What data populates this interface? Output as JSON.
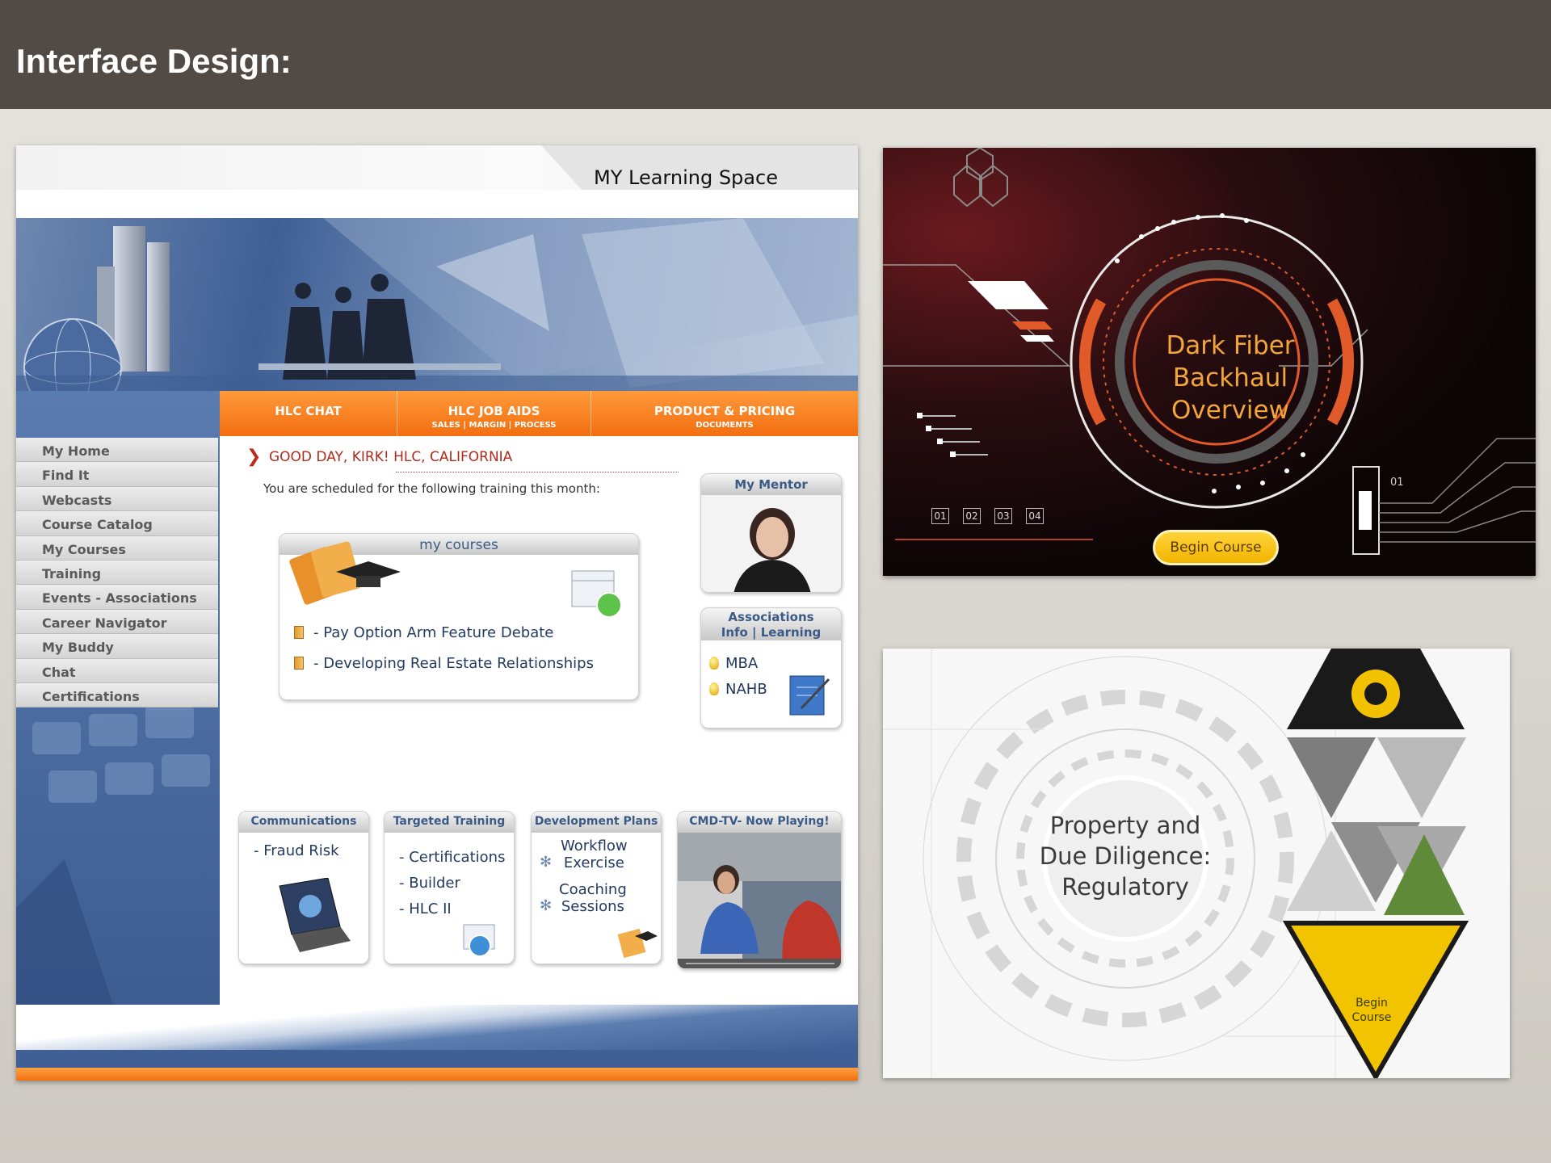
{
  "slide": {
    "title": "Interface Design:"
  },
  "lms": {
    "title": "MY Learning Space",
    "top_nav": [
      {
        "label": "HLC CHAT",
        "sub": ""
      },
      {
        "label": "HLC JOB AIDS",
        "sub": "SALES | MARGIN | PROCESS"
      },
      {
        "label": "PRODUCT & PRICING",
        "sub": "DOCUMENTS"
      }
    ],
    "left_nav": [
      "My Home",
      "Find It",
      "Webcasts",
      "Course Catalog",
      "My Courses",
      "Training",
      "Events - Associations",
      "Career Navigator",
      "My Buddy",
      "Chat",
      "Certifications"
    ],
    "greeting": "GOOD DAY, KIRK!  HLC, CALIFORNIA",
    "schedule_text": "You are scheduled for the following training this month:",
    "my_courses": {
      "title": "my courses",
      "items": [
        "- Pay Option Arm Feature Debate",
        "- Developing Real Estate Relationships"
      ]
    },
    "mentor": {
      "title": "My Mentor"
    },
    "associations": {
      "title_line1": "Associations",
      "title_line2": "Info | Learning",
      "items": [
        "MBA",
        "NAHB"
      ]
    },
    "bottom_panels": [
      {
        "title": "Communications",
        "items": [
          "- Fraud Risk"
        ]
      },
      {
        "title": "Targeted Training",
        "items": [
          "- Certifications",
          "- Builder",
          "- HLC II"
        ]
      },
      {
        "title": "Development Plans",
        "items": [
          "Workflow",
          "Exercise",
          "Coaching",
          "Sessions"
        ]
      },
      {
        "title": "CMD-TV- Now Playing!",
        "items": []
      }
    ]
  },
  "dark_course": {
    "title_lines": [
      "Dark Fiber",
      "Backhaul",
      "Overview"
    ],
    "button": "Begin Course",
    "steps": [
      "01",
      "02",
      "03",
      "04"
    ],
    "side_label": "01"
  },
  "light_course": {
    "title_lines": [
      "Property and",
      "Due Diligence:",
      "Regulatory"
    ],
    "button_lines": [
      "Begin",
      "Course"
    ]
  },
  "colors": {
    "header_bg": "#524b45",
    "lms_orange": "#f27010",
    "lms_blue": "#3f5f95",
    "dark_accent": "#f2a63a",
    "button_yellow": "#f2b400"
  }
}
